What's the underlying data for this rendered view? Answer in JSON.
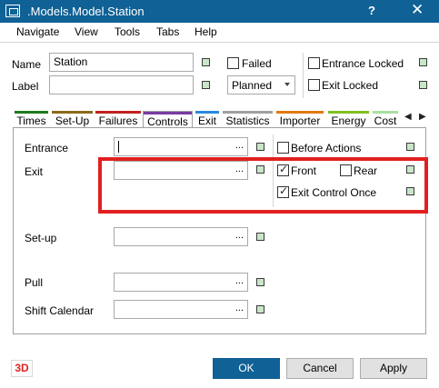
{
  "window": {
    "title": ".Models.Model.Station",
    "help_label": "?",
    "close_label": "✕"
  },
  "menu": {
    "items": [
      "Navigate",
      "View",
      "Tools",
      "Tabs",
      "Help"
    ]
  },
  "header": {
    "name_label": "Name",
    "name_value": "Station",
    "label_label": "Label",
    "label_value": "",
    "failed_label": "Failed",
    "failed_checked": false,
    "planned_value": "Planned",
    "entrance_locked_label": "Entrance Locked",
    "entrance_locked_checked": false,
    "exit_locked_label": "Exit Locked",
    "exit_locked_checked": false
  },
  "tabs": [
    {
      "label": "Times",
      "color": "#1e7a1e",
      "active": false
    },
    {
      "label": "Set-Up",
      "color": "#8a6a1a",
      "active": false
    },
    {
      "label": "Failures",
      "color": "#c02020",
      "active": false
    },
    {
      "label": "Controls",
      "color": "#7a3aa0",
      "active": true
    },
    {
      "label": "Exit",
      "color": "#2a88d8",
      "active": false
    },
    {
      "label": "Statistics",
      "color": "#a0a0a0",
      "active": false
    },
    {
      "label": "Importer",
      "color": "#e07a10",
      "active": false
    },
    {
      "label": "Energy",
      "color": "#80c020",
      "active": false
    },
    {
      "label": "Cost",
      "color": "#a8e0a0",
      "active": false
    }
  ],
  "tab_nav": {
    "left": "◀",
    "right": "▶"
  },
  "controls": {
    "entrance_label": "Entrance",
    "entrance_value": "",
    "before_actions_label": "Before Actions",
    "before_actions_checked": false,
    "exit_label": "Exit",
    "exit_value": "",
    "front_label": "Front",
    "front_checked": true,
    "rear_label": "Rear",
    "rear_checked": false,
    "exit_control_once_label": "Exit Control Once",
    "exit_control_once_checked": true,
    "setup_label": "Set-up",
    "setup_value": "",
    "pull_label": "Pull",
    "pull_value": "",
    "shift_calendar_label": "Shift Calendar",
    "shift_calendar_value": "",
    "lookup_dots": "..."
  },
  "footer": {
    "btn_3d": "3D",
    "ok": "OK",
    "cancel": "Cancel",
    "apply": "Apply"
  },
  "colors": {
    "titlebar": "#0f6196",
    "highlight": "#e02020",
    "indicator": "#c8e6c8"
  }
}
